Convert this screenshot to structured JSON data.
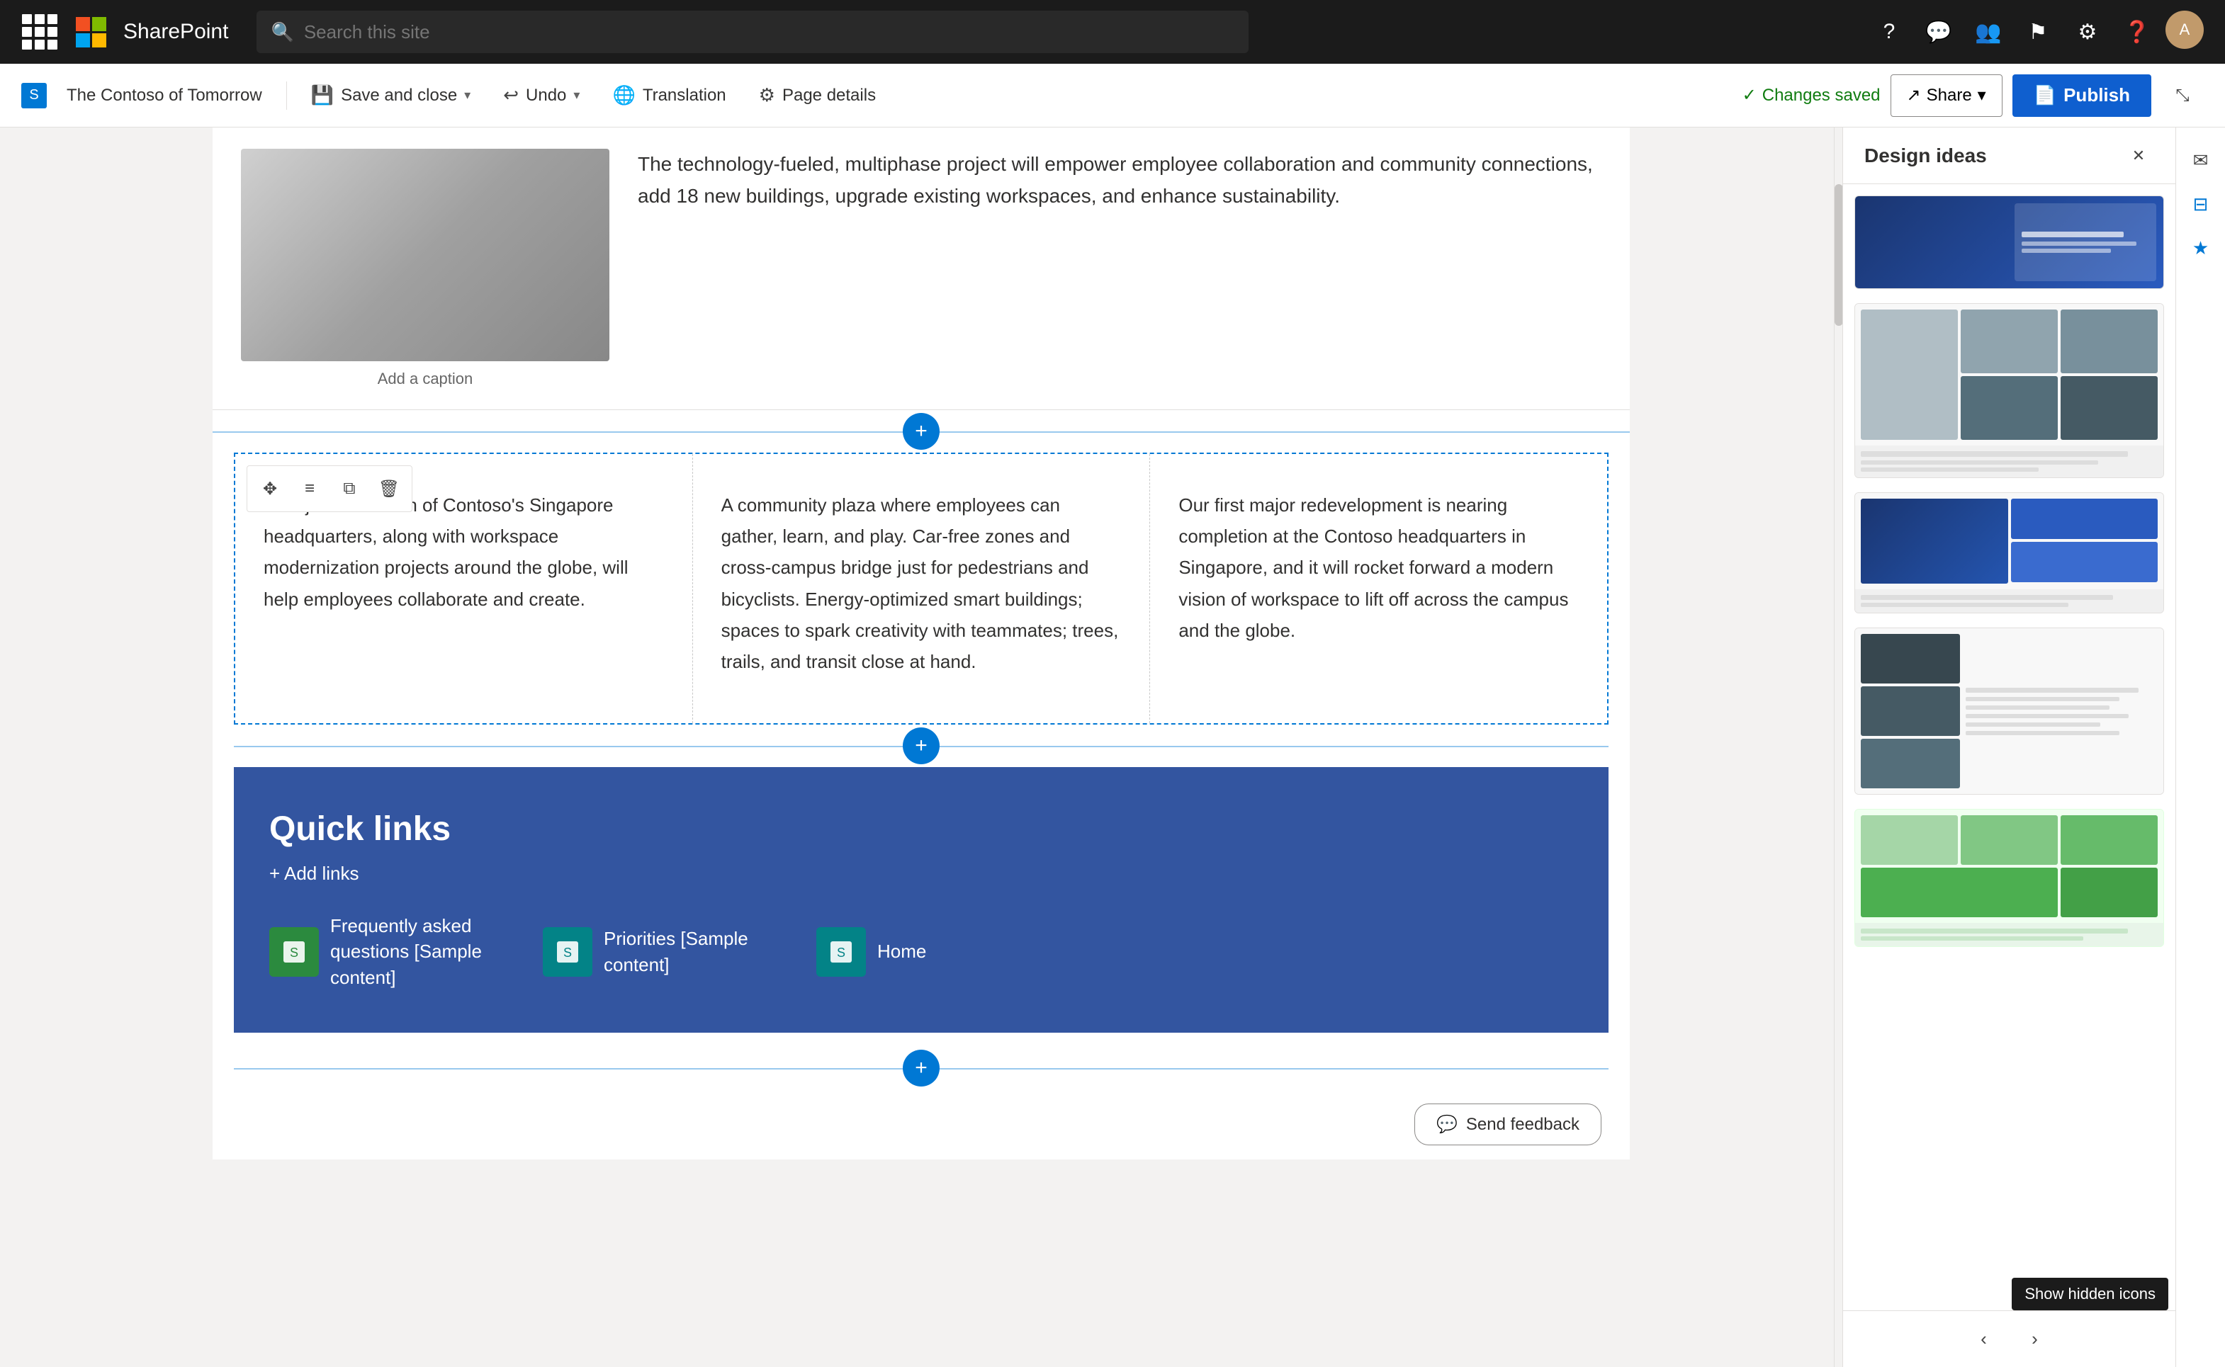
{
  "topbar": {
    "app_name": "SharePoint",
    "search_placeholder": "Search this site"
  },
  "cmdbar": {
    "site_label": "The Contoso of Tomorrow",
    "save_close_label": "Save and close",
    "undo_label": "Undo",
    "translation_label": "Translation",
    "page_details_label": "Page details",
    "changes_saved_label": "Changes saved",
    "share_label": "Share",
    "publish_label": "Publish"
  },
  "right_panel": {
    "title": "Design ideas",
    "close_tooltip": "Close"
  },
  "editor": {
    "image_caption": "Add a caption",
    "para1": "The technology-fueled, multiphase project will empower employee collaboration and community connections, add 18 new buildings, upgrade existing workspaces, and enhance sustainability.",
    "col1": "A major renovation of Contoso's Singapore headquarters, along with workspace modernization projects around the globe, will help employees collaborate and create.",
    "col2": "A community plaza where employees can gather, learn, and play. Car-free zones and cross-campus bridge just for pedestrians and bicyclists. Energy-optimized smart buildings; spaces to spark creativity with teammates; trees, trails, and transit close at hand.",
    "col3": "Our first major redevelopment is nearing completion at the Contoso headquarters in Singapore, and it will rocket forward a modern vision of workspace to lift off across the campus and the globe.",
    "quick_links_title": "Quick links",
    "add_links_label": "+ Add links",
    "link1_title": "Frequently asked questions [Sample content]",
    "link2_title": "Priorities [Sample content]",
    "link3_title": "Home"
  },
  "feedback": {
    "label": "Send feedback"
  },
  "tooltip": {
    "show_hidden": "Show hidden icons"
  }
}
